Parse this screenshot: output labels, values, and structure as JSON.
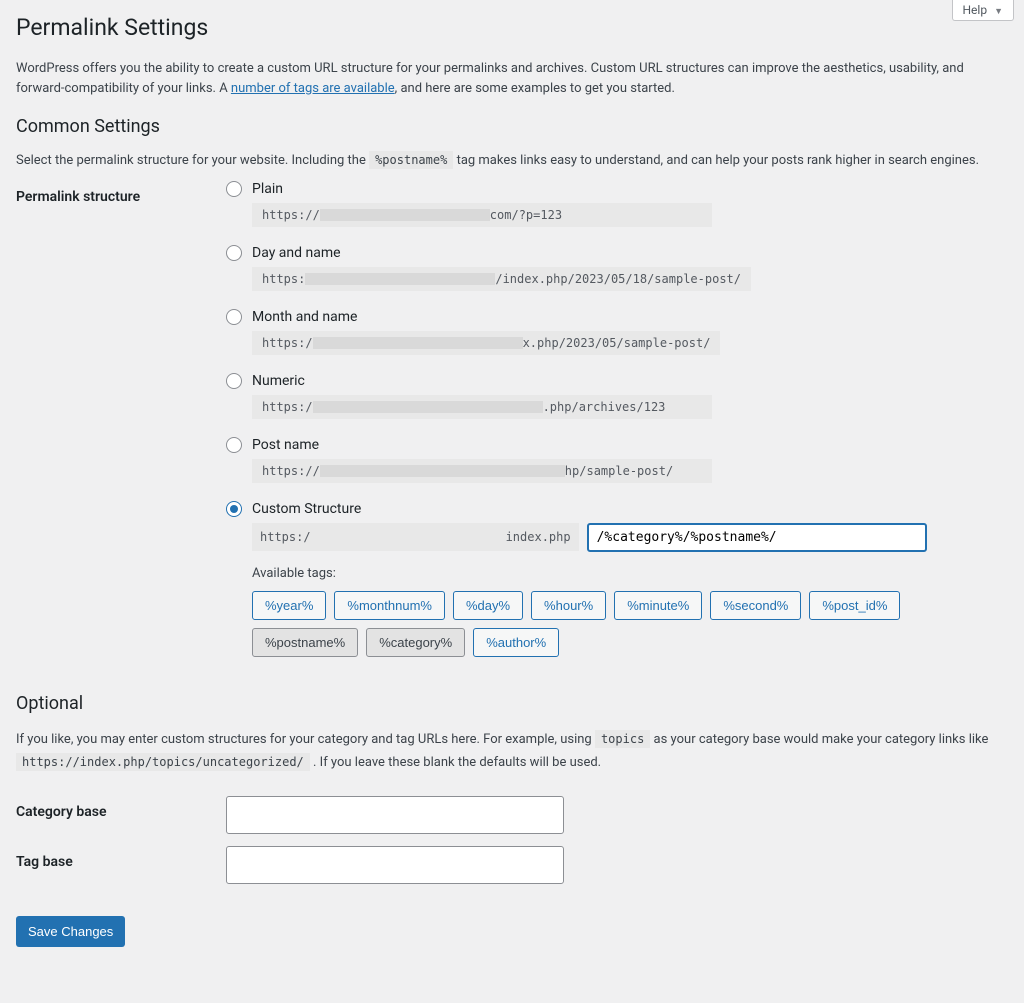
{
  "help_label": "Help",
  "page_title": "Permalink Settings",
  "intro_prefix": "WordPress offers you the ability to create a custom URL structure for your permalinks and archives. Custom URL structures can improve the aesthetics, usability, and forward-compatibility of your links. A ",
  "intro_link": "number of tags are available",
  "intro_suffix": ", and here are some examples to get you started.",
  "common_heading": "Common Settings",
  "common_desc_prefix": "Select the permalink structure for your website. Including the ",
  "common_desc_tag": "%postname%",
  "common_desc_suffix": " tag makes links easy to understand, and can help your posts rank higher in search engines.",
  "structure_label": "Permalink structure",
  "options": {
    "plain": {
      "label": "Plain",
      "url_prefix": "https://",
      "url_suffix": "com/?p=123"
    },
    "day": {
      "label": "Day and name",
      "url_prefix": "https:",
      "url_suffix": "/index.php/2023/05/18/sample-post/"
    },
    "month": {
      "label": "Month and name",
      "url_prefix": "https:/",
      "url_suffix": "x.php/2023/05/sample-post/"
    },
    "numeric": {
      "label": "Numeric",
      "url_prefix": "https:/",
      "url_suffix": ".php/archives/123"
    },
    "post": {
      "label": "Post name",
      "url_prefix": "https://",
      "url_suffix": "hp/sample-post/"
    },
    "custom": {
      "label": "Custom Structure",
      "url_prefix": "https:/",
      "url_suffix": "index.php"
    }
  },
  "custom_value": "/%category%/%postname%/",
  "available_tags_label": "Available tags:",
  "tags": {
    "year": "%year%",
    "monthnum": "%monthnum%",
    "day": "%day%",
    "hour": "%hour%",
    "minute": "%minute%",
    "second": "%second%",
    "post_id": "%post_id%",
    "postname": "%postname%",
    "category": "%category%",
    "author": "%author%"
  },
  "optional_heading": "Optional",
  "optional_desc_prefix": "If you like, you may enter custom structures for your category and tag URLs here. For example, using ",
  "optional_desc_code1": "topics",
  "optional_desc_mid": " as your category base would make your category links like ",
  "optional_desc_code2_prefix": "https:/",
  "optional_desc_code2_suffix": "/index.php/topics/uncategorized/",
  "optional_desc_suffix": " . If you leave these blank the defaults will be used.",
  "category_base_label": "Category base",
  "tag_base_label": "Tag base",
  "save_button": "Save Changes"
}
